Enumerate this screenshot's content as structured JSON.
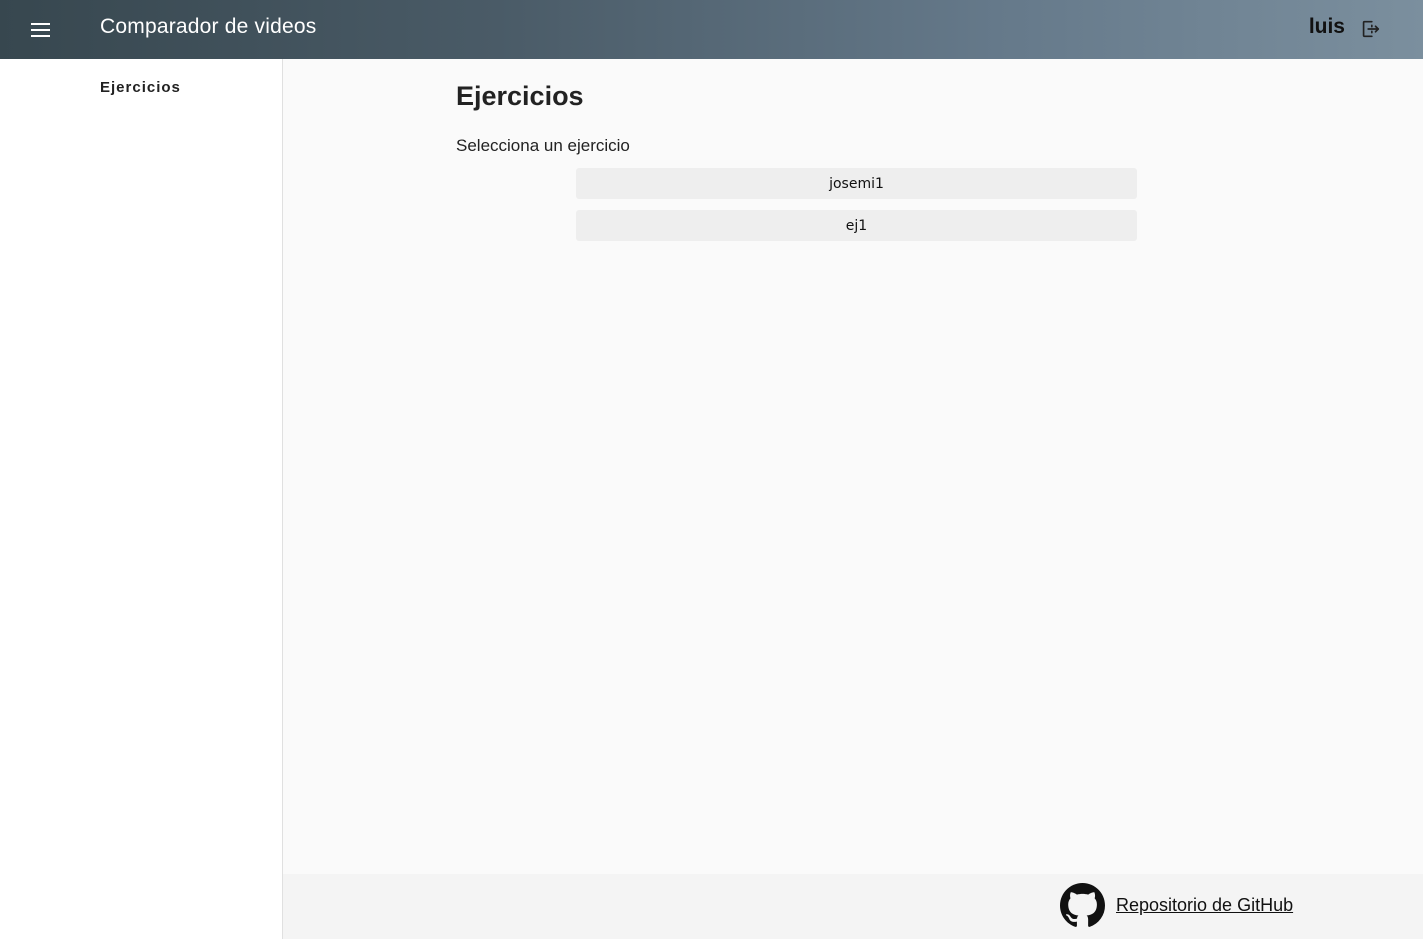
{
  "header": {
    "title": "Comparador de videos",
    "username": "luis",
    "menu_icon": "hamburger-menu-icon",
    "logout_icon": "logout-icon"
  },
  "sidebar": {
    "items": [
      {
        "label": "Ejercicios"
      }
    ]
  },
  "main": {
    "title": "Ejercicios",
    "subtitle": "Selecciona un ejercicio",
    "exercises": [
      {
        "label": "josemi1"
      },
      {
        "label": "ej1"
      }
    ]
  },
  "footer": {
    "link_label": "Repositorio de GitHub",
    "icon": "github-icon"
  },
  "colors": {
    "header_gradient_start": "#37474f",
    "header_gradient_end": "#7b8f9e",
    "button_bg": "#eeeeee",
    "footer_bg": "#f4f4f4"
  }
}
